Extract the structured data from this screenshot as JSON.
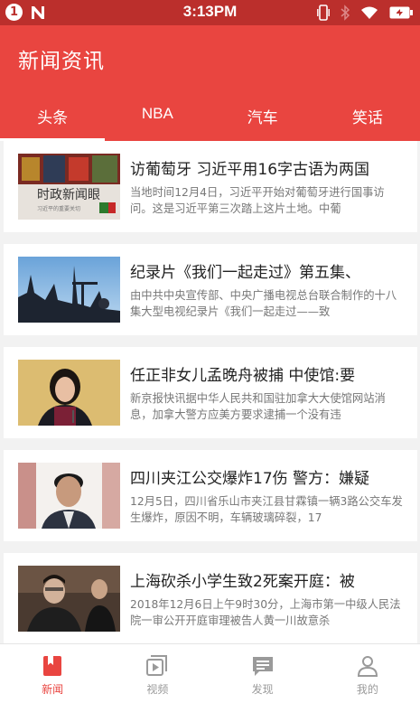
{
  "status_bar": {
    "notification_count": "1",
    "time": "3:13PM"
  },
  "app": {
    "title": "新闻资讯",
    "accent_color": "#e94540"
  },
  "tabs": [
    {
      "label": "头条",
      "active": true
    },
    {
      "label": "NBA",
      "active": false
    },
    {
      "label": "汽车",
      "active": false
    },
    {
      "label": "笑话",
      "active": false
    }
  ],
  "news": [
    {
      "title": "访葡萄牙 习近平用16字古语为两国",
      "summary": "当地时间12月4日，习近平开始对葡萄牙进行国事访问。这是习近平第三次踏上这片土地。中葡",
      "thumb_caption": "时政新闻眼",
      "thumb_subcaption": "习近平的重要关切"
    },
    {
      "title": "纪录片《我们一起走过》第五集、",
      "summary": "由中共中央宣传部、中央广播电视总台联合制作的十八集大型电视纪录片《我们一起走过——致"
    },
    {
      "title": "任正非女儿孟晚舟被捕 中使馆:要",
      "summary": "新京报快讯据中华人民共和国驻加拿大大使馆网站消息，加拿大警方应美方要求逮捕一个没有违"
    },
    {
      "title": "四川夹江公交爆炸17伤 警方：嫌疑",
      "summary": "12月5日，四川省乐山市夹江县甘霖镇一辆3路公交车发生爆炸，原因不明，车辆玻璃碎裂，17"
    },
    {
      "title": "上海砍杀小学生致2死案开庭：被",
      "summary": "2018年12月6日上午9时30分，上海市第一中级人民法院一审公开开庭审理被告人黄一川故意杀"
    }
  ],
  "bottom_nav": [
    {
      "label": "新闻",
      "icon": "bookmark-book-icon",
      "active": true
    },
    {
      "label": "视频",
      "icon": "video-play-icon",
      "active": false
    },
    {
      "label": "发现",
      "icon": "chat-bubble-icon",
      "active": false
    },
    {
      "label": "我的",
      "icon": "person-icon",
      "active": false
    }
  ]
}
